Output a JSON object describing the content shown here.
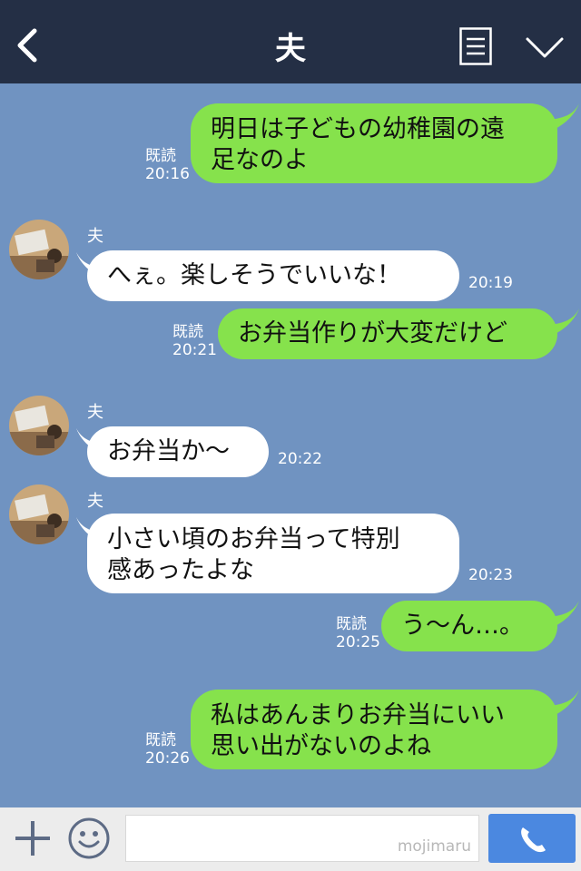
{
  "header": {
    "title": "夫",
    "back_icon": "chevron-left-icon",
    "menu_icon": "list-icon",
    "collapse_icon": "chevron-down-icon"
  },
  "messages": [
    {
      "dir": "out",
      "lines": [
        "明日は子どもの幼稚園の遠",
        "足なのよ"
      ],
      "read": "既読",
      "time": "20:16"
    },
    {
      "dir": "in",
      "sender": "夫",
      "lines": [
        "へぇ。楽しそうでいいな！"
      ],
      "time": "20:19"
    },
    {
      "dir": "out",
      "lines": [
        "お弁当作りが大変だけど"
      ],
      "read": "既読",
      "time": "20:21"
    },
    {
      "dir": "in",
      "sender": "夫",
      "lines": [
        "お弁当か〜"
      ],
      "time": "20:22"
    },
    {
      "dir": "in",
      "sender": "夫",
      "lines": [
        "小さい頃のお弁当って特別",
        "感あったよな"
      ],
      "time": "20:23"
    },
    {
      "dir": "out",
      "lines": [
        "う〜ん…。"
      ],
      "read": "既読",
      "time": "20:25"
    },
    {
      "dir": "out",
      "lines": [
        "私はあんまりお弁当にいい",
        "思い出がないのよね"
      ],
      "read": "既読",
      "time": "20:26"
    }
  ],
  "footer": {
    "plus_icon": "plus-icon",
    "emoji_icon": "smiley-icon",
    "input_value": "",
    "watermark": "mojimaru",
    "call_icon": "phone-icon"
  },
  "colors": {
    "header_bg": "#242f45",
    "chat_bg": "#7093c1",
    "outgoing_bubble": "#86e24c",
    "incoming_bubble": "#ffffff",
    "call_button": "#4b88e0"
  }
}
